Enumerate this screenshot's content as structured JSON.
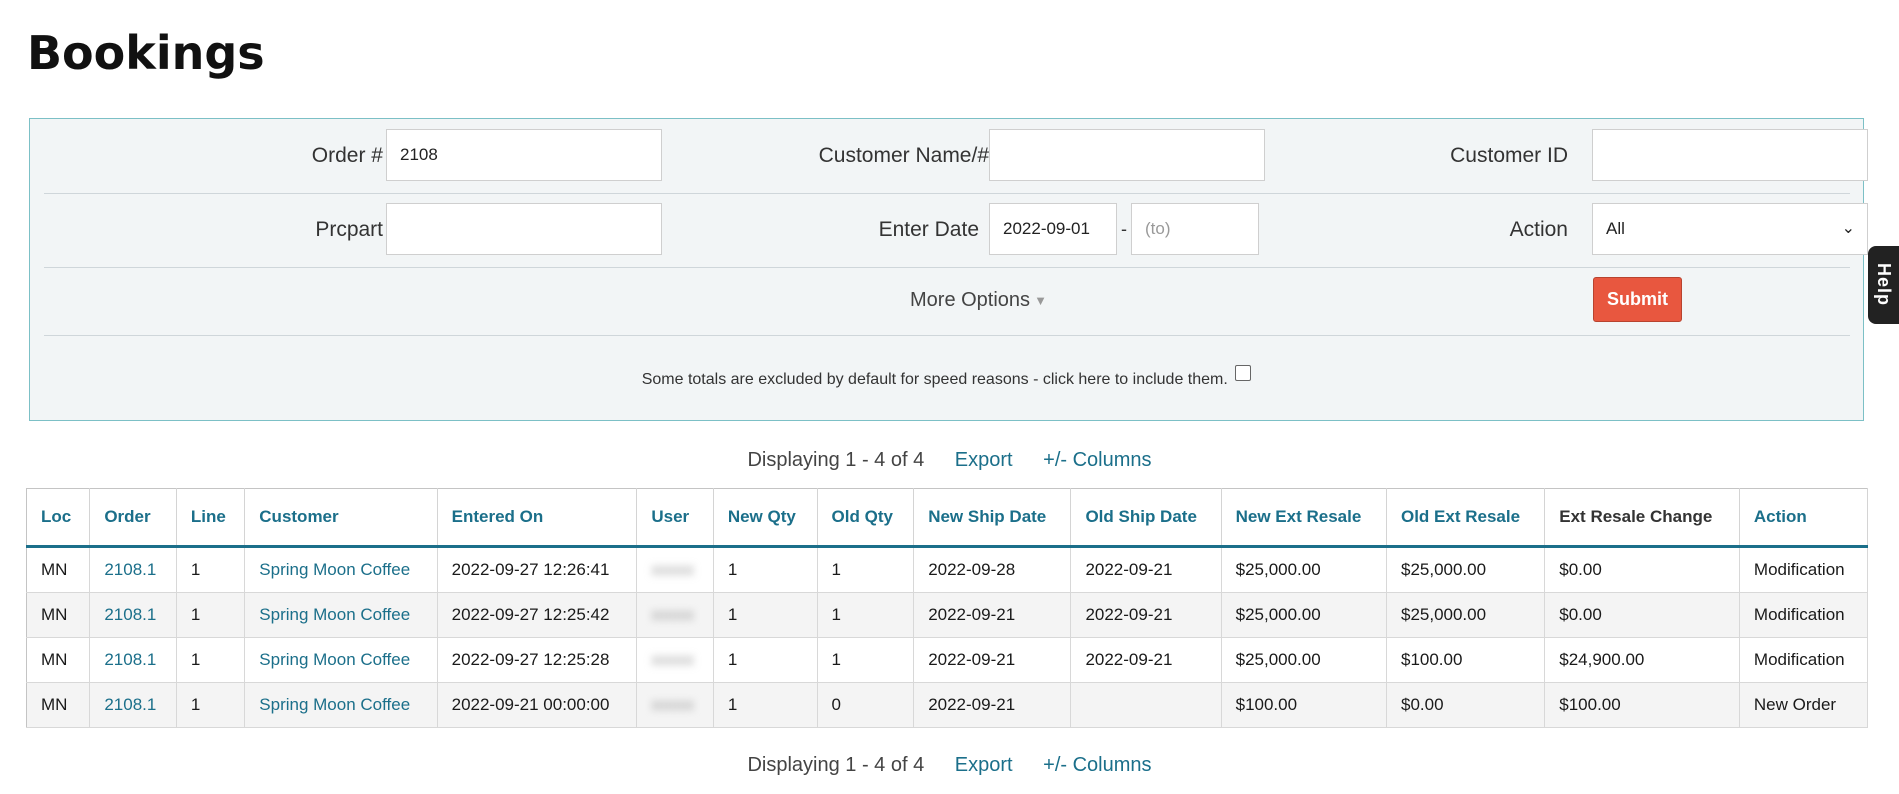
{
  "title": "Bookings",
  "filters": {
    "order_label": "Order #",
    "order_value": "2108",
    "customer_name_label": "Customer Name/#",
    "customer_name_value": "",
    "customer_id_label": "Customer ID",
    "customer_id_value": "",
    "prcpart_label": "Prcpart",
    "prcpart_value": "",
    "enter_date_label": "Enter Date",
    "enter_date_from": "2022-09-01",
    "enter_date_separator": "-",
    "enter_date_to_placeholder": "(to)",
    "action_label": "Action",
    "action_selected": "All",
    "more_options": "More Options",
    "submit": "Submit",
    "totals_note": "Some totals are excluded by default for speed reasons - click here to include them."
  },
  "pager": {
    "text": "Displaying 1 - 4 of 4",
    "export": "Export",
    "columns": "+/- Columns"
  },
  "table": {
    "headers": [
      "Loc",
      "Order",
      "Line",
      "Customer",
      "Entered On",
      "User",
      "New Qty",
      "Old Qty",
      "New Ship Date",
      "Old Ship Date",
      "New Ext Resale",
      "Old Ext Resale",
      "Ext Resale Change",
      "Action"
    ],
    "rows": [
      {
        "loc": "MN",
        "order": "2108.1",
        "line": "1",
        "customer": "Spring Moon Coffee",
        "entered_on": "2022-09-27 12:26:41",
        "user": "xxxxx",
        "new_qty": "1",
        "old_qty": "1",
        "new_ship_date": "2022-09-28",
        "old_ship_date": "2022-09-21",
        "new_ext_resale": "$25,000.00",
        "old_ext_resale": "$25,000.00",
        "ext_resale_change": "$0.00",
        "action": "Modification"
      },
      {
        "loc": "MN",
        "order": "2108.1",
        "line": "1",
        "customer": "Spring Moon Coffee",
        "entered_on": "2022-09-27 12:25:42",
        "user": "xxxxx",
        "new_qty": "1",
        "old_qty": "1",
        "new_ship_date": "2022-09-21",
        "old_ship_date": "2022-09-21",
        "new_ext_resale": "$25,000.00",
        "old_ext_resale": "$25,000.00",
        "ext_resale_change": "$0.00",
        "action": "Modification"
      },
      {
        "loc": "MN",
        "order": "2108.1",
        "line": "1",
        "customer": "Spring Moon Coffee",
        "entered_on": "2022-09-27 12:25:28",
        "user": "xxxxx",
        "new_qty": "1",
        "old_qty": "1",
        "new_ship_date": "2022-09-21",
        "old_ship_date": "2022-09-21",
        "new_ext_resale": "$25,000.00",
        "old_ext_resale": "$100.00",
        "ext_resale_change": "$24,900.00",
        "action": "Modification"
      },
      {
        "loc": "MN",
        "order": "2108.1",
        "line": "1",
        "customer": "Spring Moon Coffee",
        "entered_on": "2022-09-21 00:00:00",
        "user": "xxxxx",
        "new_qty": "1",
        "old_qty": "0",
        "new_ship_date": "2022-09-21",
        "old_ship_date": "",
        "new_ext_resale": "$100.00",
        "old_ext_resale": "$0.00",
        "ext_resale_change": "$100.00",
        "action": "New Order"
      }
    ]
  },
  "help": "Help"
}
